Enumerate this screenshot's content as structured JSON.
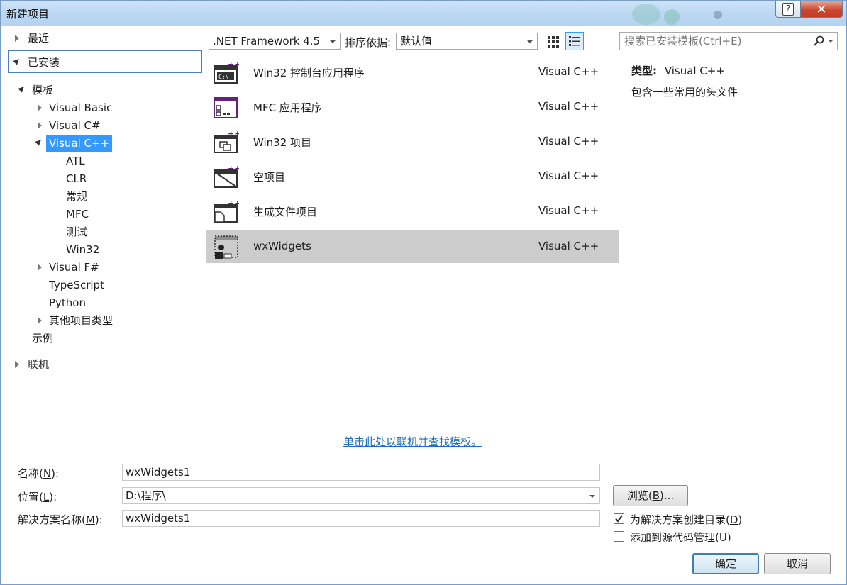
{
  "window": {
    "title": "新建项目",
    "help_label": "?",
    "close_label": "✕"
  },
  "tree": {
    "recent": "最近",
    "installed": "已安装",
    "templates": "模板",
    "visual_basic": "Visual Basic",
    "visual_csharp": "Visual C#",
    "visual_cpp": "Visual C++",
    "cpp_children": [
      "ATL",
      "CLR",
      "常规",
      "MFC",
      "测试",
      "Win32"
    ],
    "visual_fsharp": "Visual F#",
    "typescript": "TypeScript",
    "python": "Python",
    "other_types": "其他项目类型",
    "samples": "示例",
    "online": "联机"
  },
  "toolbar": {
    "framework": ".NET Framework 4.5",
    "sort_label": "排序依据:",
    "sort_value": "默认值",
    "search_placeholder": "搜索已安装模板(Ctrl+E)"
  },
  "templates": [
    {
      "name": "Win32 控制台应用程序",
      "lang": "Visual C++",
      "icon": "console-app-icon"
    },
    {
      "name": "MFC 应用程序",
      "lang": "Visual C++",
      "icon": "mfc-app-icon"
    },
    {
      "name": "Win32 项目",
      "lang": "Visual C++",
      "icon": "win32-project-icon"
    },
    {
      "name": "空项目",
      "lang": "Visual C++",
      "icon": "empty-project-icon"
    },
    {
      "name": "生成文件项目",
      "lang": "Visual C++",
      "icon": "makefile-project-icon"
    },
    {
      "name": "wxWidgets",
      "lang": "Visual C++",
      "icon": "wxwidgets-icon",
      "selected": true
    }
  ],
  "details": {
    "type_label": "类型:",
    "type_value": "Visual C++",
    "description": "包含一些常用的头文件"
  },
  "online_link": "单击此处以联机并查找模板。",
  "form": {
    "name_label": "名称(N):",
    "name_label_parts": [
      "名称(",
      "N",
      "):"
    ],
    "name_value": "wxWidgets1",
    "location_label_parts": [
      "位置(",
      "L",
      "):"
    ],
    "location_value": "D:\\程序\\",
    "solution_label_parts": [
      "解决方案名称(",
      "M",
      "):"
    ],
    "solution_value": "wxWidgets1",
    "browse_parts": [
      "浏览(",
      "B",
      ")..."
    ],
    "create_dir_parts": [
      "为解决方案创建目录(",
      "D",
      ")"
    ],
    "create_dir_checked": true,
    "source_control_parts": [
      "添加到源代码管理(",
      "U",
      ")"
    ],
    "source_control_checked": false,
    "ok_label": "确定",
    "cancel_label": "取消"
  }
}
